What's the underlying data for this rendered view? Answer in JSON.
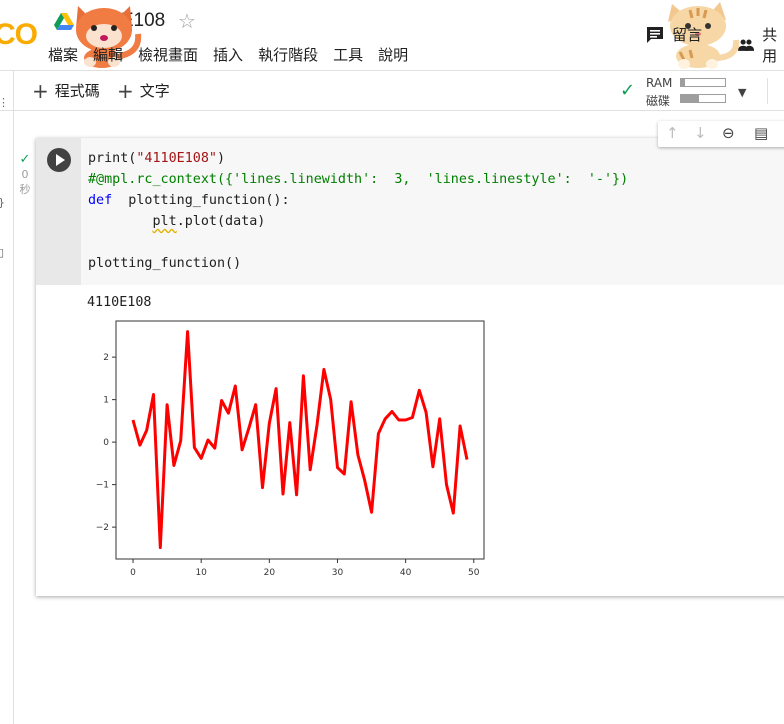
{
  "header": {
    "logo_text": "CO",
    "notebook_title": "4110E108",
    "star_icon": "star-outline-icon",
    "comment_label": "留言",
    "share_label": "共用"
  },
  "menu": {
    "items": [
      "檔案",
      "編輯",
      "檢視畫面",
      "插入",
      "執行階段",
      "工具",
      "說明"
    ]
  },
  "toolbar": {
    "add_code_label": "程式碼",
    "add_text_label": "文字",
    "ram_label": "RAM",
    "disk_label": "磁碟",
    "ram_usage": 0.08,
    "disk_usage": 0.4,
    "status_color": "#0f9d58"
  },
  "cell": {
    "exec_time": "0",
    "exec_unit": "秒",
    "code_lines": [
      "print(\"4110E108\")",
      "#@mpl.rc_context({'lines.linewidth':  3,  'lines.linestyle':  '-'})",
      "def  plotting_function():",
      "        plt.plot(data)",
      "",
      "plotting_function()"
    ],
    "output_text": "4110E108"
  },
  "chart_data": {
    "type": "line",
    "title": "",
    "xlabel": "",
    "ylabel": "",
    "xlim": [
      -2.5,
      51.5
    ],
    "ylim": [
      -2.75,
      2.85
    ],
    "xticks": [
      0,
      10,
      20,
      30,
      40,
      50
    ],
    "yticks": [
      -2,
      -1,
      0,
      1,
      2
    ],
    "grid": false,
    "series": [
      {
        "color": "#ff0000",
        "linewidth": 3,
        "x": [
          0,
          1,
          2,
          3,
          4,
          5,
          6,
          7,
          8,
          9,
          10,
          11,
          12,
          13,
          14,
          15,
          16,
          17,
          18,
          19,
          20,
          21,
          22,
          23,
          24,
          25,
          26,
          27,
          28,
          29,
          30,
          31,
          32,
          33,
          34,
          35,
          36,
          37,
          38,
          39,
          40,
          41,
          42,
          43,
          44,
          45,
          46,
          47,
          48,
          49
        ],
        "y": [
          0.52,
          -0.07,
          0.28,
          1.12,
          -2.48,
          0.88,
          -0.55,
          0.03,
          2.6,
          -0.13,
          -0.38,
          0.05,
          -0.14,
          0.98,
          0.68,
          1.32,
          -0.18,
          0.33,
          0.88,
          -1.07,
          0.44,
          1.26,
          -1.22,
          0.46,
          -1.24,
          1.56,
          -0.65,
          0.4,
          1.71,
          1.0,
          -0.6,
          -0.75,
          0.95,
          -0.3,
          -0.9,
          -1.65,
          0.2,
          0.55,
          0.72,
          0.52,
          0.52,
          0.58,
          1.22,
          0.7,
          -0.58,
          0.55,
          -1.0,
          -1.67,
          0.38,
          -0.41
        ]
      }
    ]
  }
}
